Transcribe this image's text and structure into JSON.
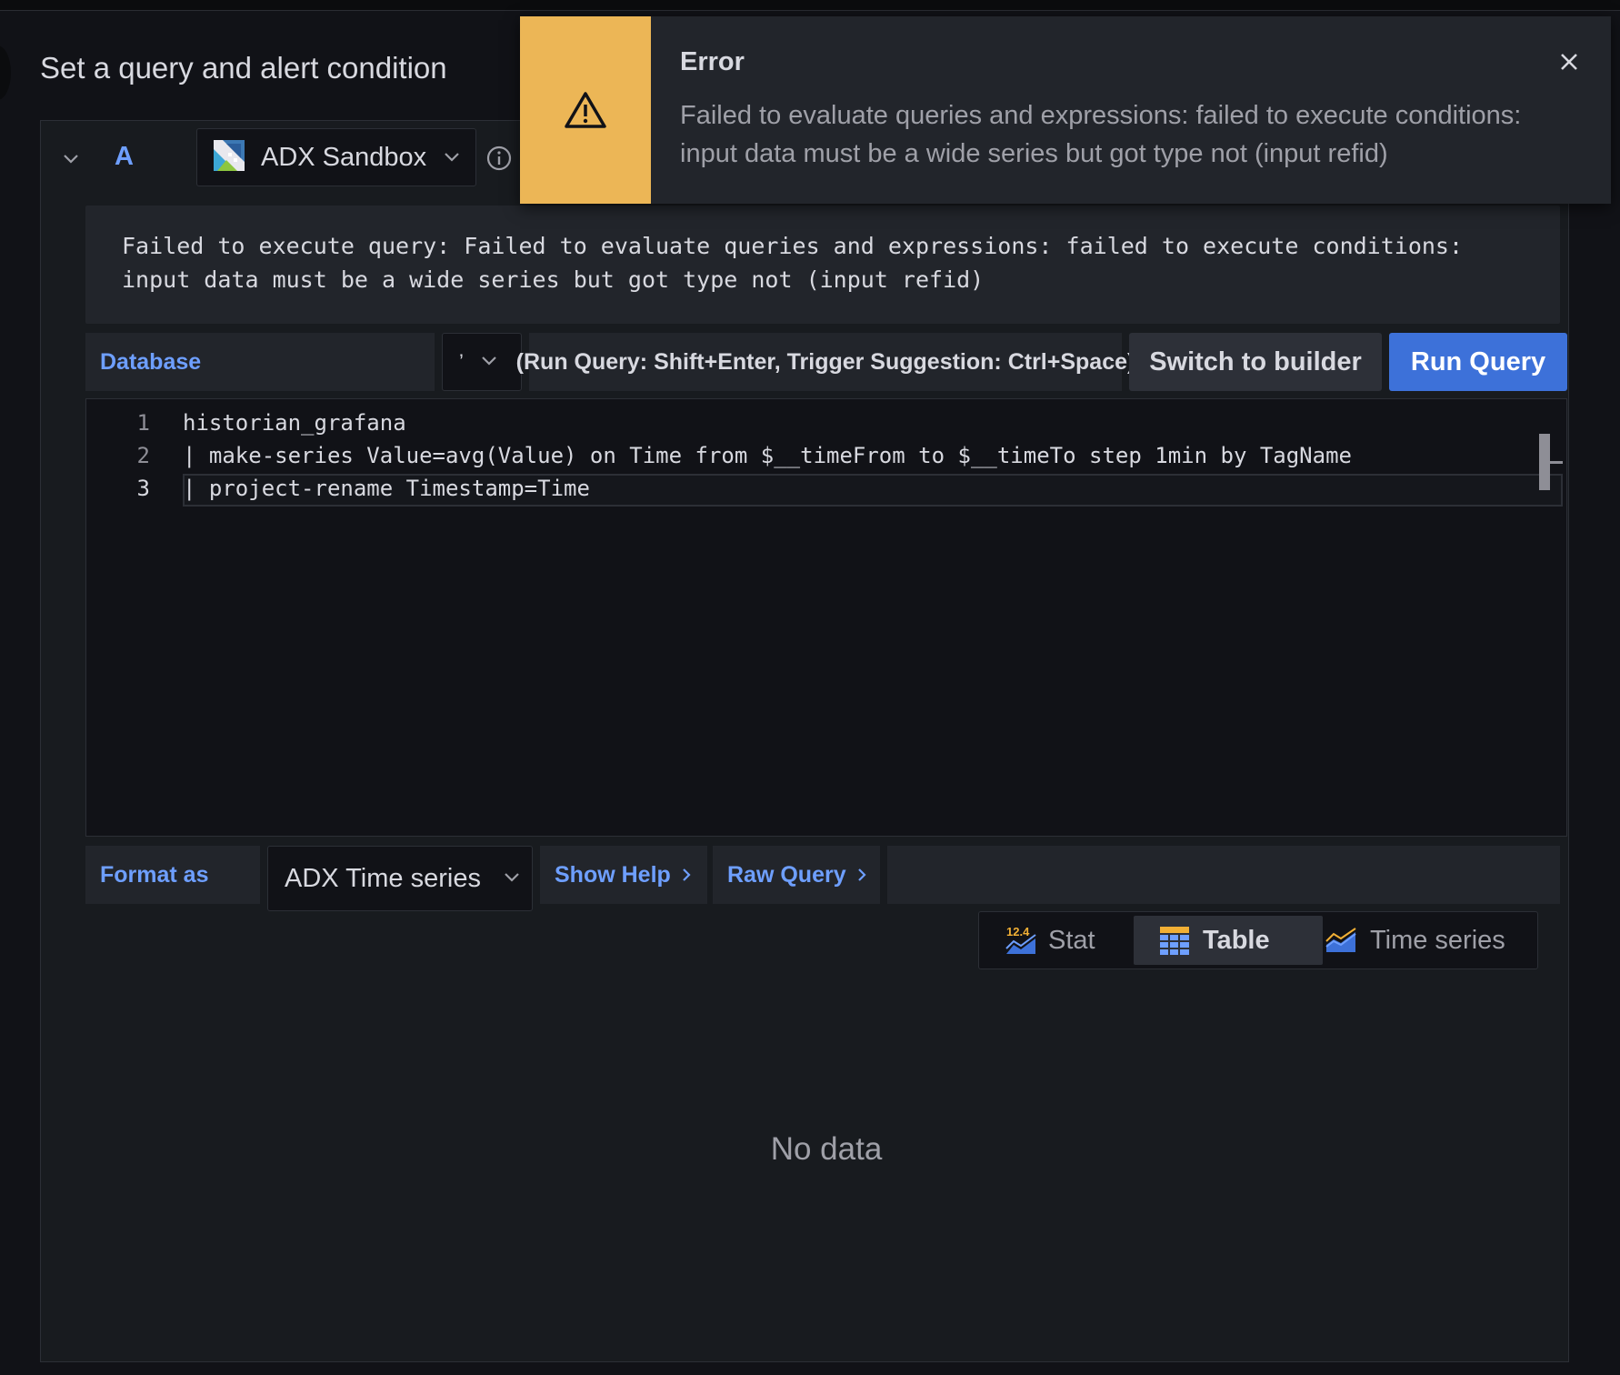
{
  "page": {
    "title": "Set a query and alert condition"
  },
  "query": {
    "ref_id": "A",
    "datasource": {
      "name": "ADX Sandbox",
      "icon": "adx-logo-icon"
    },
    "error_message": "Failed to execute query: Failed to evaluate queries and expressions: failed to execute conditions: input data must be a wide series but got type not (input refid)"
  },
  "toolbar": {
    "database_label": "Database",
    "database_value": "’",
    "hint": "(Run Query: Shift+Enter, Trigger Suggestion: Ctrl+Space)",
    "switch_label": "Switch to builder",
    "run_label": "Run Query"
  },
  "editor": {
    "lines": [
      {
        "number": "1",
        "text": "historian_grafana"
      },
      {
        "number": "2",
        "text": "| make-series Value=avg(Value) on Time from $__timeFrom to $__timeTo step 1min by TagName"
      },
      {
        "number": "3",
        "text": "| project-rename Timestamp=Time"
      }
    ]
  },
  "options": {
    "format_label": "Format as",
    "format_value": "ADX Time series",
    "show_help": "Show Help",
    "raw_query": "Raw Query"
  },
  "viz": {
    "options": [
      {
        "label": "Stat",
        "icon": "stat-icon",
        "badge": "12.4"
      },
      {
        "label": "Table",
        "icon": "table-icon",
        "active": true
      },
      {
        "label": "Time series",
        "icon": "time-series-icon"
      }
    ]
  },
  "result": {
    "empty_text": "No data"
  },
  "toast": {
    "title": "Error",
    "message": "Failed to evaluate queries and expressions: failed to execute conditions: input data must be a wide series but got type not (input refid)",
    "icon": "warning-icon",
    "color": "#ecb656"
  },
  "colors": {
    "accent": "#6e9fff",
    "primary_button": "#3d71d9",
    "background": "#111217"
  }
}
